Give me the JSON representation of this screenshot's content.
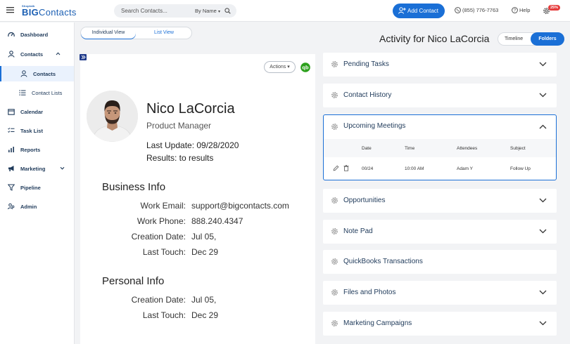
{
  "header": {
    "logo_small": "Shoptalk",
    "logo_big_bold": "BIG",
    "logo_big_rest": "Contacts",
    "search_placeholder": "Search Contacts...",
    "search_by": "By Name",
    "add_contact": "Add Contact",
    "phone": "(855) 776-7763",
    "help": "Help",
    "badge": "25%"
  },
  "sidebar": {
    "items": [
      {
        "label": "Dashboard"
      },
      {
        "label": "Contacts"
      },
      {
        "label": "Contacts"
      },
      {
        "label": "Contact Lists"
      },
      {
        "label": "Calendar"
      },
      {
        "label": "Task List"
      },
      {
        "label": "Reports"
      },
      {
        "label": "Marketing"
      },
      {
        "label": "Pipeline"
      },
      {
        "label": "Admin"
      }
    ]
  },
  "view_toggle": {
    "individual": "Individual View",
    "list": "List View"
  },
  "activity": {
    "title": "Activity for Nico LaCorcia",
    "timeline": "Timeline",
    "folders": "Folders"
  },
  "contact": {
    "actions": "Actions",
    "name": "Nico LaCorcia",
    "role": "Product Manager",
    "last_update": "Last Update: 09/28/2020",
    "results": "Results: to results",
    "business": {
      "title": "Business Info",
      "rows": [
        {
          "k": "Work Email:",
          "v": "support@bigcontacts.com"
        },
        {
          "k": "Work Phone:",
          "v": "888.240.4347"
        },
        {
          "k": "Creation Date:",
          "v": "Jul 05,"
        },
        {
          "k": "Last Touch:",
          "v": "Dec 29"
        }
      ]
    },
    "personal": {
      "title": "Personal Info",
      "rows": [
        {
          "k": "Creation Date:",
          "v": "Jul 05,"
        },
        {
          "k": "Last Touch:",
          "v": "Dec 29"
        }
      ]
    }
  },
  "accordions": [
    {
      "label": "Pending Tasks"
    },
    {
      "label": "Contact History"
    },
    {
      "label": "Upcoming Meetings"
    },
    {
      "label": "Opportunities"
    },
    {
      "label": "Note Pad"
    },
    {
      "label": "QuickBooks Transactions"
    },
    {
      "label": "Files and Photos"
    },
    {
      "label": "Marketing Campaigns"
    }
  ],
  "meetings": {
    "headers": {
      "date": "Date",
      "time": "Time",
      "attendees": "Attendees",
      "subject": "Subject"
    },
    "row": {
      "date": "00/24",
      "time": "10:00 AM",
      "attendees": "Adam Y",
      "subject": "Follow Up"
    }
  },
  "colors": {
    "accent": "#1a6fd6",
    "nav_text": "#1f3a5a",
    "badge": "#e53b3b"
  }
}
